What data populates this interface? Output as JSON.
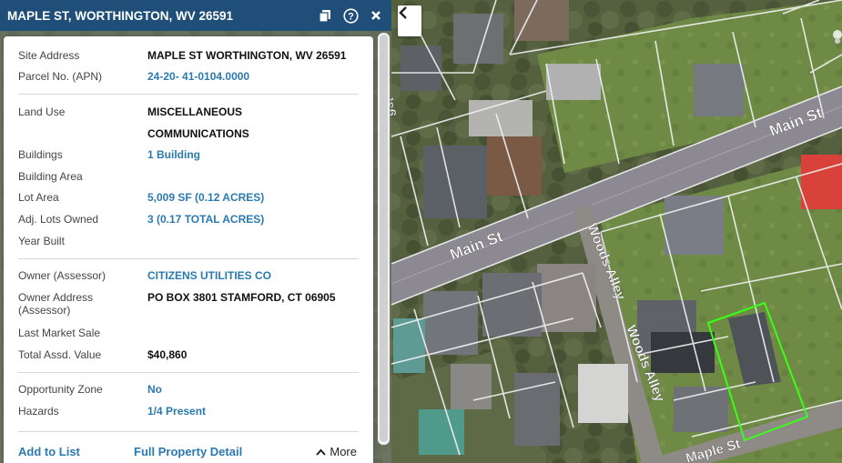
{
  "header": {
    "title": "MAPLE ST, WORTHINGTON, WV 26591"
  },
  "details": {
    "site_address_label": "Site Address",
    "site_address": "MAPLE ST WORTHINGTON, WV 26591",
    "parcel_label": "Parcel No. (APN)",
    "parcel": "24-20- 41-0104.0000",
    "land_use_label": "Land Use",
    "land_use_line1": "MISCELLANEOUS",
    "land_use_line2": "COMMUNICATIONS",
    "buildings_label": "Buildings",
    "buildings": "1 Building",
    "building_area_label": "Building Area",
    "lot_area_label": "Lot Area",
    "lot_area": "5,009 SF (0.12 ACRES)",
    "adj_lots_label": "Adj. Lots Owned",
    "adj_lots": "3 (0.17 TOTAL ACRES)",
    "year_built_label": "Year Built",
    "owner_label": "Owner (Assessor)",
    "owner": "CITIZENS UTILITIES CO",
    "owner_address_label_1": "Owner Address",
    "owner_address_label_2": "(Assessor)",
    "owner_address": "PO BOX 3801 STAMFORD, CT 06905",
    "last_sale_label": "Last Market Sale",
    "total_value_label": "Total Assd. Value",
    "total_value": "$40,860",
    "opportunity_label": "Opportunity Zone",
    "opportunity": "No",
    "hazards_label": "Hazards",
    "hazards": "1/4 Present"
  },
  "footer": {
    "add_to_list": "Add to List",
    "full_detail": "Full Property Detail",
    "more": "More"
  },
  "map": {
    "street_main_1": "Main St",
    "street_main_2": "Main St",
    "street_woods_1": "Woods Alley",
    "street_woods_2": "Woods Alley",
    "street_maple": "Maple St",
    "street_partial": "gst"
  },
  "colors": {
    "header_bg": "#1f4e79",
    "link": "#2a7ab0",
    "parcel_highlight": "#39ff14"
  },
  "icons": [
    "copy-icon",
    "help-icon",
    "close-icon",
    "chevron-left-icon",
    "chevron-up-icon"
  ]
}
